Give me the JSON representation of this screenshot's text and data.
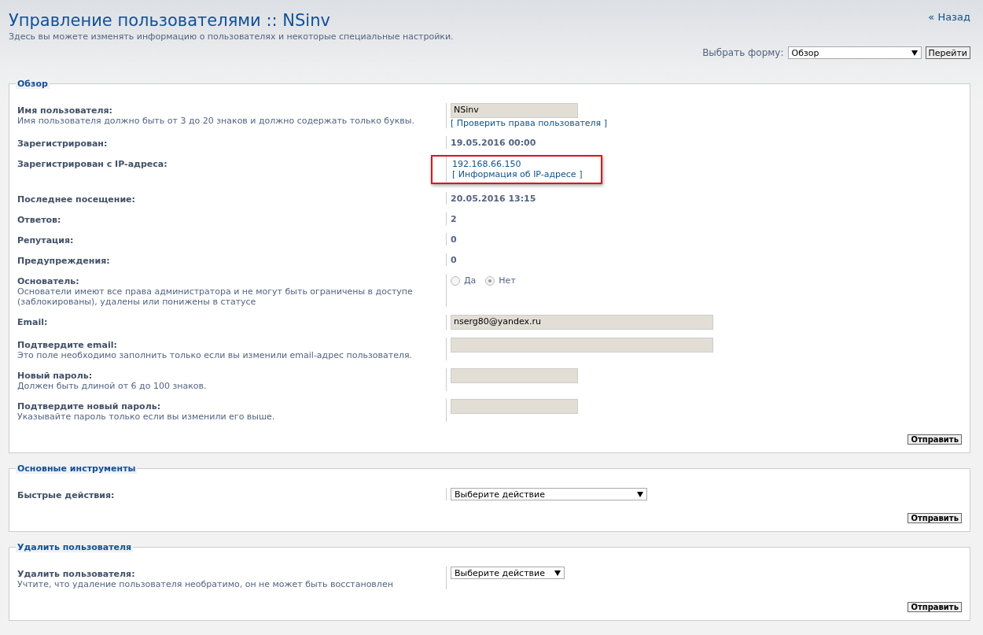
{
  "header": {
    "title": "Управление пользователями :: NSinv",
    "description": "Здесь вы можете изменять информацию о пользователях и некоторые специальные настройки.",
    "back_link": "« Назад",
    "form_select": {
      "label": "Выбрать форму:",
      "value": "Обзор",
      "button": "Перейти"
    }
  },
  "fieldsets": [
    {
      "legend": "Обзор",
      "rows": [
        {
          "kind": "input",
          "label": "Имя пользователя:",
          "explain": "Имя пользователя должно быть от 3 до 20 знаков и должно содержать только буквы.",
          "value": "NSinv",
          "link": "[ Проверить права пользователя ]"
        },
        {
          "kind": "static",
          "label": "Зарегистрирован:",
          "value": "19.05.2016 00:00"
        },
        {
          "kind": "ip",
          "label": "Зарегистрирован с IP-адреса:",
          "value": "192.168.66.150",
          "link": "[ Информация об IP-адресе ]",
          "highlighted": true
        },
        {
          "kind": "static",
          "label": "Последнее посещение:",
          "value": "20.05.2016 13:15"
        },
        {
          "kind": "static",
          "label": "Ответов:",
          "value": "2"
        },
        {
          "kind": "static",
          "label": "Репутация:",
          "value": "0"
        },
        {
          "kind": "static",
          "label": "Предупреждения:",
          "value": "0"
        },
        {
          "kind": "radio",
          "label": "Основатель:",
          "explain": "Основатели имеют все права администратора и не могут быть ограничены в доступе (заблокированы), удалены или понижены в статусе",
          "options": [
            {
              "label": "Да",
              "selected": false
            },
            {
              "label": "Нет",
              "selected": true
            }
          ]
        },
        {
          "kind": "input-wide",
          "label": "Email:",
          "value": "nserg80@yandex.ru"
        },
        {
          "kind": "input-wide",
          "label": "Подтвердите email:",
          "explain": "Это поле необходимо заполнить только если вы изменили email-адрес пользователя."
        },
        {
          "kind": "input",
          "label": "Новый пароль:",
          "explain": "Должен быть длиной от 6 до 100 знаков."
        },
        {
          "kind": "input",
          "label": "Подтвердите новый пароль:",
          "explain": "Указывайте пароль только если вы изменили его выше."
        }
      ],
      "submit": "Отправить"
    },
    {
      "legend": "Основные инструменты",
      "rows": [
        {
          "kind": "select-wide",
          "label": "Быстрые действия:",
          "value": "Выберите действие"
        }
      ],
      "submit": "Отправить"
    },
    {
      "legend": "Удалить пользователя",
      "rows": [
        {
          "kind": "select",
          "label": "Удалить пользователя:",
          "explain": "Учтите, что удаление пользователя необратимо, он не может быть восстановлен",
          "value": "Выберите действие"
        }
      ],
      "submit": "Отправить"
    }
  ]
}
